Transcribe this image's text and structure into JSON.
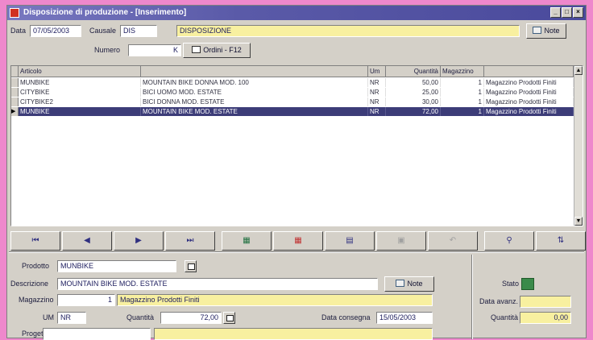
{
  "window": {
    "title": "Disposizione di produzione - [Inserimento]",
    "controls": [
      "_",
      "□",
      "×"
    ]
  },
  "header": {
    "data_label": "Data",
    "data_value": "07/05/2003",
    "causale_label": "Causale",
    "causale_code": "DIS",
    "causale_desc": "DISPOSIZIONE",
    "numero_label": "Numero",
    "numero_value": "",
    "numero_suffix": "K",
    "ordini_button": "Ordini - F12",
    "note_button": "Note"
  },
  "grid": {
    "columns": [
      "Articolo",
      "",
      "Um",
      "Quantità",
      "Magazzino",
      ""
    ],
    "rows": [
      {
        "articolo": "MUNBIKE",
        "descrizione": "MOUNTAIN BIKE DONNA MOD. 100",
        "um": "NR",
        "quantita": "50,00",
        "mag": "1",
        "mag_desc": "Magazzino Prodotti Finiti",
        "selected": false
      },
      {
        "articolo": "CITYBIKE",
        "descrizione": "BICI UOMO MOD. ESTATE",
        "um": "NR",
        "quantita": "25,00",
        "mag": "1",
        "mag_desc": "Magazzino Prodotti Finiti",
        "selected": false
      },
      {
        "articolo": "CITYBIKE2",
        "descrizione": "BICI DONNA MOD. ESTATE",
        "um": "NR",
        "quantita": "30,00",
        "mag": "1",
        "mag_desc": "Magazzino Prodotti Finiti",
        "selected": false
      },
      {
        "articolo": "MUNBIKE",
        "descrizione": "MOUNTAIN BIKE MOD. ESTATE",
        "um": "NR",
        "quantita": "72,00",
        "mag": "1",
        "mag_desc": "Magazzino Prodotti Finiti",
        "selected": true
      }
    ]
  },
  "nav": {
    "buttons": [
      {
        "name": "first-record-button",
        "glyph": "⏮",
        "cls": ""
      },
      {
        "name": "prev-record-button",
        "glyph": "◀",
        "cls": ""
      },
      {
        "name": "next-record-button",
        "glyph": "▶",
        "cls": ""
      },
      {
        "name": "last-record-button",
        "glyph": "⏭",
        "cls": ""
      },
      {
        "name": "insert-row-button",
        "glyph": "▦",
        "cls": "grn"
      },
      {
        "name": "delete-row-button",
        "glyph": "▦",
        "cls": "red"
      },
      {
        "name": "edit-row-button",
        "glyph": "▤",
        "cls": ""
      },
      {
        "name": "save-row-button",
        "glyph": "▣",
        "cls": "dis"
      },
      {
        "name": "undo-row-button",
        "glyph": "↶",
        "cls": "dis"
      },
      {
        "name": "search-button",
        "glyph": "⚲",
        "cls": ""
      },
      {
        "name": "sort-button",
        "glyph": "⇅",
        "cls": ""
      }
    ]
  },
  "detail": {
    "prodotto_label": "Prodotto",
    "prodotto_value": "MUNBIKE",
    "descrizione_label": "Descrizione",
    "descrizione_value": "MOUNTAIN BIKE MOD. ESTATE",
    "note_button": "Note",
    "magazzino_label": "Magazzino",
    "magazzino_code": "1",
    "magazzino_desc": "Magazzino Prodotti Finiti",
    "um_label": "UM",
    "um_value": "NR",
    "quantita_label": "Quantità",
    "quantita_value": "72,00",
    "consegna_label": "Data consegna",
    "consegna_value": "15/05/2003",
    "progetto_label": "Progetto",
    "progetto_value": ""
  },
  "side": {
    "stato_label": "Stato",
    "stato_color": "#3a8a4a",
    "data_avanzamento_label": "Data avanz.",
    "data_avanzamento_value": "",
    "quantita_label": "Quantità",
    "quantita_value": "0,00"
  }
}
